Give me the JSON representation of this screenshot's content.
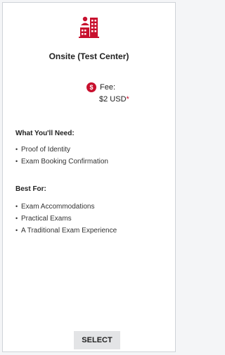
{
  "card": {
    "icon": "test-center-building-icon",
    "title": "Onsite (Test Center)",
    "fee": {
      "icon": "dollar-icon",
      "symbol": "$",
      "label": "Fee:",
      "amount": "$2 USD",
      "asterisk": "*"
    },
    "needs": {
      "heading": "What You'll Need:",
      "items": [
        "Proof of Identity",
        "Exam Booking Confirmation"
      ]
    },
    "best_for": {
      "heading": "Best For:",
      "items": [
        "Exam Accommodations",
        "Practical Exams",
        "A Traditional Exam Experience"
      ]
    },
    "select_label": "SELECT"
  },
  "colors": {
    "accent": "#c8102e",
    "button_bg": "#e3e4e6",
    "border": "#cfd3d8"
  }
}
